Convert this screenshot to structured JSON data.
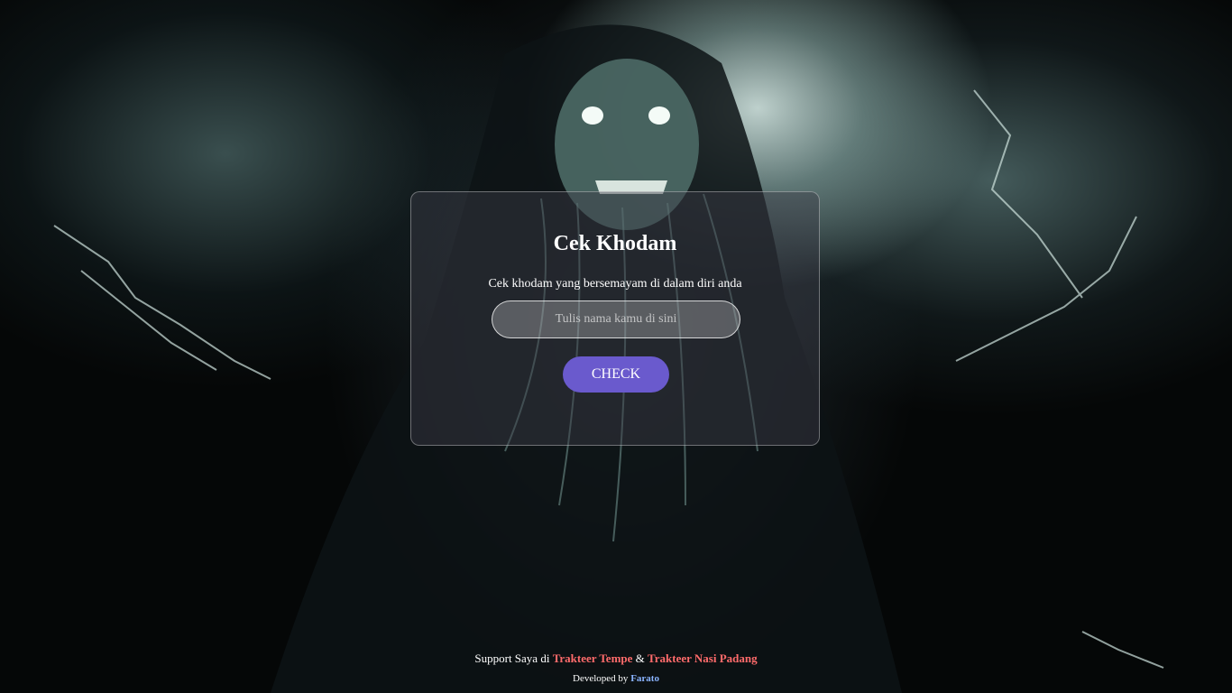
{
  "page": {
    "title": "Cek Khodam",
    "subtitle": "Cek khodam yang bersemayam di dalam diri anda"
  },
  "form": {
    "name_placeholder": "Tulis nama kamu di sini",
    "name_value": "",
    "check_label": "CHECK",
    "button_color": "#6a5acd"
  },
  "footer": {
    "support_prefix": "Support Saya di ",
    "link_tempe": "Trakteer Tempe",
    "separator": " & ",
    "link_nasi_padang": "Trakteer Nasi Padang",
    "developed_by": "Developed by ",
    "developer": "Farato",
    "link_color": "#ff6b6b",
    "developer_color": "#8ab4ff"
  }
}
